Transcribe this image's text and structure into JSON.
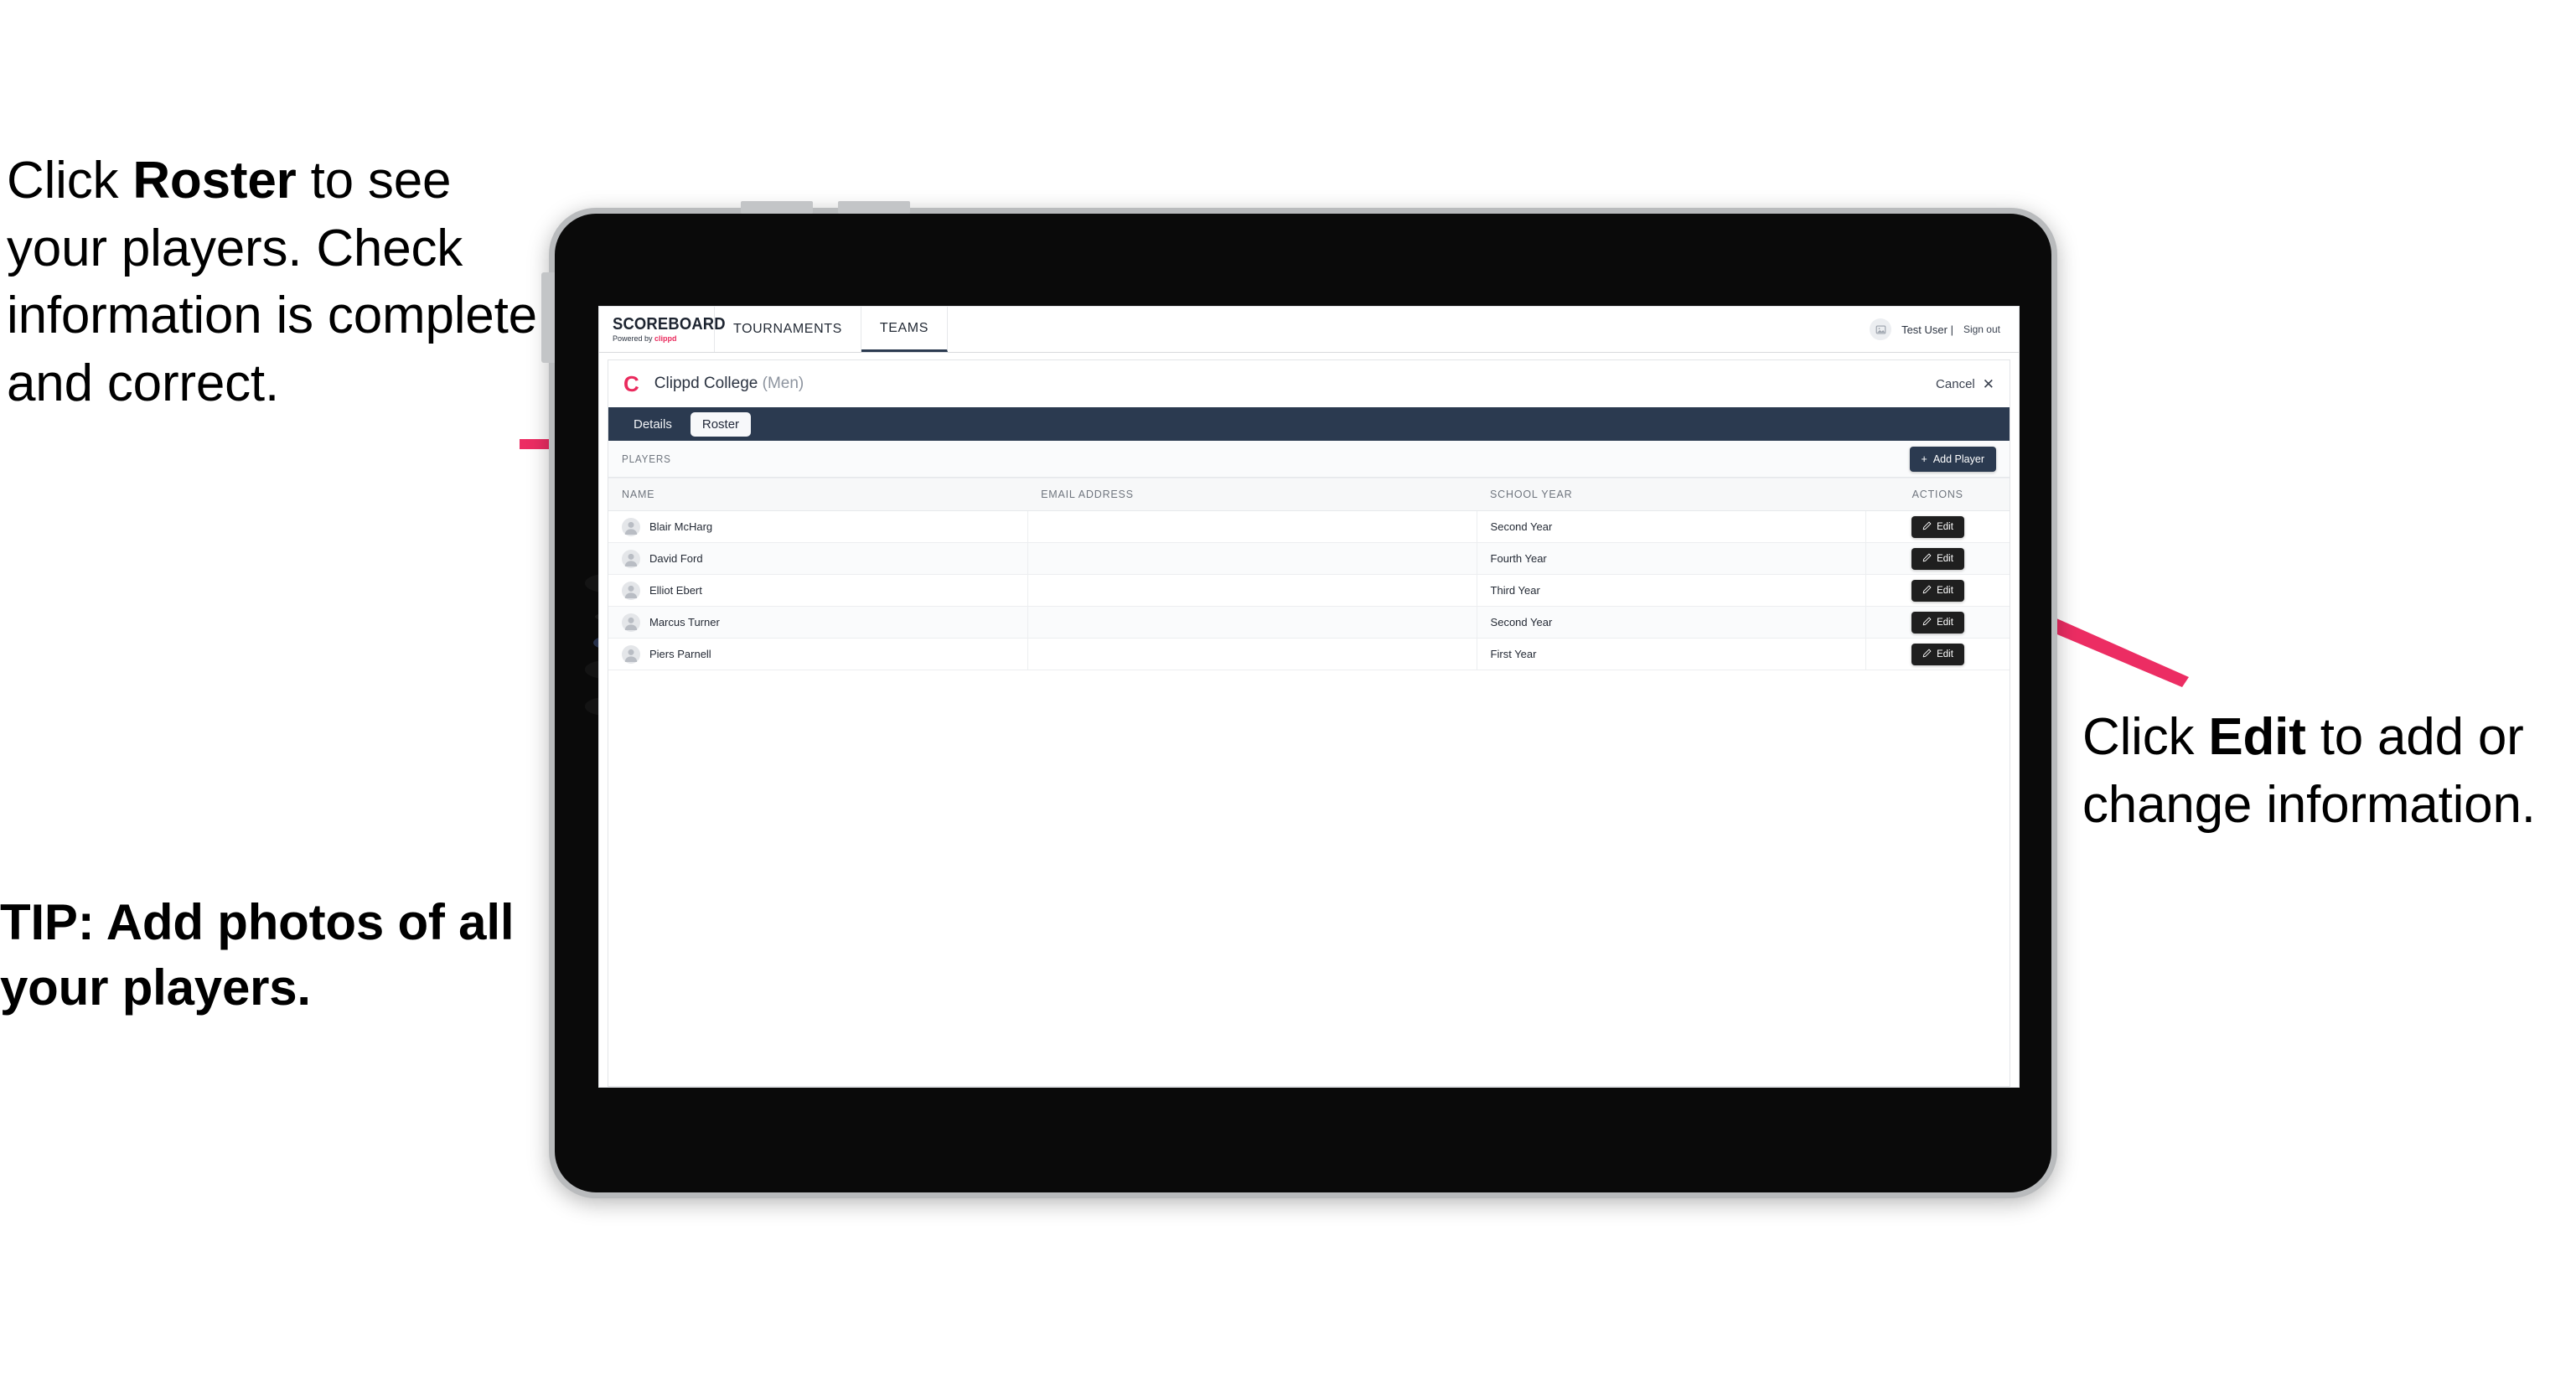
{
  "annotations": {
    "left": {
      "pre": "Click ",
      "bold": "Roster",
      "post": " to see your players. Check information is complete and correct."
    },
    "tip": "TIP: Add photos of all your players.",
    "right": {
      "pre": "Click ",
      "bold": "Edit",
      "post": " to add or change information."
    },
    "arrow_color": "#ec2d63"
  },
  "app": {
    "brand": {
      "title": "SCOREBOARD",
      "powered_prefix": "Powered by ",
      "powered_brand": "clippd"
    },
    "nav_tabs": [
      {
        "label": "TOURNAMENTS",
        "active": false
      },
      {
        "label": "TEAMS",
        "active": true
      }
    ],
    "user": {
      "name": "Test User |",
      "sign_out": "Sign out",
      "avatar_icon": "image-placeholder-icon"
    },
    "accent_color": "#ea2a5d",
    "navy_color": "#2b3a50"
  },
  "page": {
    "team_initial": "C",
    "team_name": "Clippd College",
    "team_gender": "(Men)",
    "cancel_label": "Cancel",
    "cancel_icon": "close-icon",
    "sub_tabs": [
      {
        "label": "Details",
        "active": false
      },
      {
        "label": "Roster",
        "active": true
      }
    ]
  },
  "players_section": {
    "heading": "PLAYERS",
    "add_button": {
      "label": "Add Player",
      "icon": "plus-icon"
    },
    "columns": [
      "NAME",
      "EMAIL ADDRESS",
      "SCHOOL YEAR",
      "ACTIONS"
    ],
    "action_label": "Edit",
    "action_icon": "pencil-icon",
    "rows": [
      {
        "name": "Blair McHarg",
        "email": "",
        "school_year": "Second Year"
      },
      {
        "name": "David Ford",
        "email": "",
        "school_year": "Fourth Year"
      },
      {
        "name": "Elliot Ebert",
        "email": "",
        "school_year": "Third Year"
      },
      {
        "name": "Marcus Turner",
        "email": "",
        "school_year": "Second Year"
      },
      {
        "name": "Piers Parnell",
        "email": "",
        "school_year": "First Year"
      }
    ]
  }
}
